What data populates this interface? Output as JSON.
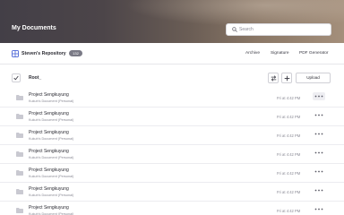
{
  "header": {
    "title": "My Documents",
    "search_placeholder": "Search"
  },
  "repository": {
    "name": "Steven's Repository",
    "count": "132",
    "nav": [
      "Archive",
      "Signature",
      "PDF Generator"
    ]
  },
  "toolbar": {
    "root_label": "Root_",
    "upload_label": "Upload"
  },
  "rows": [
    {
      "name": "Project Sengkuyung",
      "owner": "Kukuh's Document (Personal)",
      "time": "Fri at 4:42 PM"
    },
    {
      "name": "Project Sengkuyung",
      "owner": "Kukuh's Document (Personal)",
      "time": "Fri at 4:42 PM"
    },
    {
      "name": "Project Sengkuyung",
      "owner": "Kukuh's Document (Personal)",
      "time": "Fri at 4:42 PM"
    },
    {
      "name": "Project Sengkuyung",
      "owner": "Kukuh's Document (Personal)",
      "time": "Fri at 4:42 PM"
    },
    {
      "name": "Project Sengkuyung",
      "owner": "Kukuh's Document (Personal)",
      "time": "Fri at 4:42 PM"
    },
    {
      "name": "Project Sengkuyung",
      "owner": "Kukuh's Document (Personal)",
      "time": "Fri at 4:42 PM"
    },
    {
      "name": "Project Sengkuyung",
      "owner": "Kukuh's Document (Personal)",
      "time": "Fri at 4:42 PM"
    }
  ],
  "icons": {
    "search": "search-icon",
    "repository": "grid-icon",
    "check": "check-icon",
    "sort": "sort-icon",
    "add": "plus-icon",
    "folder": "folder-icon",
    "more": "more-horizontal-icon"
  },
  "colors": {
    "accent_badge": "#7a7a86",
    "banner_dark": "#433f47",
    "banner_light": "#a48f7b"
  }
}
